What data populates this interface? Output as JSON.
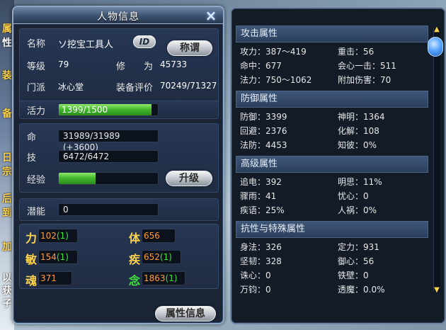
{
  "panel": {
    "title": "人物信息",
    "close_icon": "×",
    "name_label": "名称",
    "name_value": "ソ挖宝工具人",
    "id_badge": "ID",
    "title_button": "称谓",
    "level_label": "等级",
    "level_value": "79",
    "cultivation_label": "修　　为",
    "cultivation_value": "45733",
    "sect_label": "门派",
    "sect_value": "冰心堂",
    "equip_label": "装备评价",
    "equip_value": "70249/71327",
    "vitality_label": "活力",
    "vitality_text": "1399/1500",
    "vitality_ratio": 0.933,
    "life_label": "命",
    "life_value": "31989/31989 (+3600)",
    "skill_label": "技",
    "skill_value": "6472/6472",
    "exp_label": "经验",
    "exp_ratio": 0.37,
    "upgrade_button": "升级",
    "potential_label": "潜能",
    "potential_value": "0",
    "attributes": [
      {
        "label": "力",
        "base": "102",
        "bonus": "(1)"
      },
      {
        "label": "体",
        "base": "656",
        "bonus": ""
      },
      {
        "label": "敏",
        "base": "154",
        "bonus": "(1)"
      },
      {
        "label": "疾",
        "base": "652",
        "bonus": "(1)"
      },
      {
        "label": "魂",
        "base": "371",
        "bonus": ""
      },
      {
        "label": "念",
        "base": "1863",
        "bonus": "(1)"
      }
    ],
    "attr_info_button": "属性信息"
  },
  "stats": {
    "groups": [
      {
        "header": "攻击属性",
        "rows": [
          [
            "攻力：387～419",
            "重击：56"
          ],
          [
            "命中：677",
            "会心一击：511"
          ],
          [
            "法力：750～1062",
            "附加伤害：70"
          ]
        ]
      },
      {
        "header": "防御属性",
        "rows": [
          [
            "防御：3399",
            "神明：1364"
          ],
          [
            "回避：2376",
            "化解：108"
          ],
          [
            "法防：4453",
            "知彼：0%"
          ]
        ]
      },
      {
        "header": "高级属性",
        "rows": [
          [
            "追电：392",
            "明思：11%"
          ],
          [
            "骤雨：41",
            "忧心：0"
          ],
          [
            "疾语：25%",
            "人祸：0%"
          ]
        ]
      },
      {
        "header": "抗性与特殊属性",
        "rows": [
          [
            "身法：326",
            "定力：931"
          ],
          [
            "坚韧：328",
            "御心：56"
          ],
          [
            "诛心：0",
            "铁壁：0"
          ],
          [
            "万钧：0",
            "透魔：0.0%"
          ]
        ]
      }
    ]
  },
  "background_chars": [
    "属",
    "性",
    "装",
    "备",
    "日",
    "宗",
    "后",
    "到",
    "加",
    "以",
    "获",
    "子"
  ],
  "colors": {
    "attr_label": "#ffd34a",
    "attr_base": "#ff9a3c",
    "attr_bonus": "#3fe23f",
    "bar_fill": "#3fb52a"
  }
}
